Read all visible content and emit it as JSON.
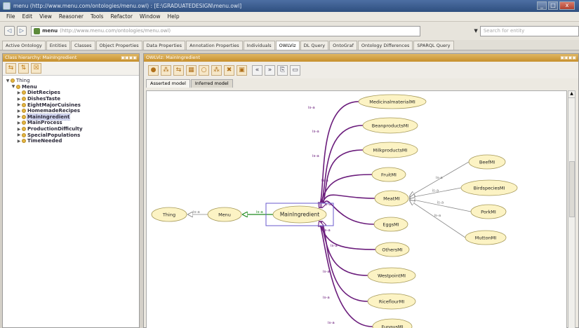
{
  "window": {
    "title": "menu (http://www.menu.com/ontologies/menu.owl) : [E:\\GRADUATEDESIGN\\menu.owl]",
    "btn_min": "_",
    "btn_max": "□",
    "btn_close": "x"
  },
  "menubar": [
    "File",
    "Edit",
    "View",
    "Reasoner",
    "Tools",
    "Refactor",
    "Window",
    "Help"
  ],
  "address": {
    "back_icon": "◁",
    "forward_icon": "▷",
    "ontology_name": "menu",
    "ontology_uri": "(http://www.menu.com/ontologies/menu.owl)",
    "search_placeholder": "Search for entity",
    "dropdown_arrow": "▼"
  },
  "tabs": [
    "Active Ontology",
    "Entities",
    "Classes",
    "Object Properties",
    "Data Properties",
    "Annotation Properties",
    "Individuals",
    "OWLViz",
    "DL Query",
    "OntoGraf",
    "Ontology Differences",
    "SPARQL Query"
  ],
  "active_tab_index": 7,
  "left_panel": {
    "header": "Class hierarchy: MainIngredient",
    "header_buttons": "▣▣▣▣",
    "toolbar_icons": [
      "⇆",
      "⇅",
      "☒"
    ],
    "tree": [
      {
        "label": "Thing",
        "level": 0,
        "twisty": "▼",
        "selected": false
      },
      {
        "label": "Menu",
        "level": 1,
        "twisty": "▼",
        "selected": false
      },
      {
        "label": "DietRecipes",
        "level": 2,
        "twisty": "▶",
        "selected": false
      },
      {
        "label": "DishesTaste",
        "level": 2,
        "twisty": "▶",
        "selected": false
      },
      {
        "label": "EightMajorCuisines",
        "level": 2,
        "twisty": "▶",
        "selected": false
      },
      {
        "label": "HomemadeRecipes",
        "level": 2,
        "twisty": "▶",
        "selected": false
      },
      {
        "label": "MainIngredient",
        "level": 2,
        "twisty": "▶",
        "selected": true
      },
      {
        "label": "MainProcess",
        "level": 2,
        "twisty": "▶",
        "selected": false
      },
      {
        "label": "ProductionDifficulty",
        "level": 2,
        "twisty": "▶",
        "selected": false
      },
      {
        "label": "SpecialPopulations",
        "level": 2,
        "twisty": "▶",
        "selected": false
      },
      {
        "label": "TimeNeeded",
        "level": 2,
        "twisty": "▶",
        "selected": false
      }
    ]
  },
  "right_panel": {
    "header": "OWLViz: MainIngredient",
    "header_buttons": "▣▣▣▣",
    "toolbar_icons": [
      "●",
      "⁂",
      "⇆",
      "▦",
      "○",
      "⁂",
      "✖",
      "▣",
      "«",
      "»",
      "⎘",
      "▭"
    ],
    "model_tabs": [
      "Asserted model",
      "Inferred model"
    ],
    "active_model_tab": 0,
    "scroll_up": "▲"
  },
  "graph": {
    "edge_label": "is-a",
    "nodes": [
      {
        "id": "thing",
        "label": "Thing"
      },
      {
        "id": "menu",
        "label": "Menu"
      },
      {
        "id": "main",
        "label": "MainIngredient"
      },
      {
        "id": "medicinal",
        "label": "MedicinalmaterialMI"
      },
      {
        "id": "bean",
        "label": "BeanproductsMI"
      },
      {
        "id": "milk",
        "label": "MilkproductsMI"
      },
      {
        "id": "fruit",
        "label": "FruitMI"
      },
      {
        "id": "meat",
        "label": "MeatMI"
      },
      {
        "id": "eggs",
        "label": "EggsMI"
      },
      {
        "id": "others",
        "label": "OthersMI"
      },
      {
        "id": "westpoint",
        "label": "WestpointMI"
      },
      {
        "id": "riceflour",
        "label": "RiceflourMI"
      },
      {
        "id": "fungus",
        "label": "FungusMI"
      },
      {
        "id": "beef",
        "label": "BeefMI"
      },
      {
        "id": "birds",
        "label": "BirdspeciesMI"
      },
      {
        "id": "pork",
        "label": "PorkMI"
      },
      {
        "id": "mutton",
        "label": "MuttonMI"
      }
    ],
    "colors": {
      "node_fill": "#fcf3c4",
      "node_stroke": "#a69a5a",
      "main_edge": "#6b1d7c",
      "menu_edge": "#1e8a1e",
      "gray_edge": "#888888",
      "select_box": "#6a5acd"
    }
  }
}
